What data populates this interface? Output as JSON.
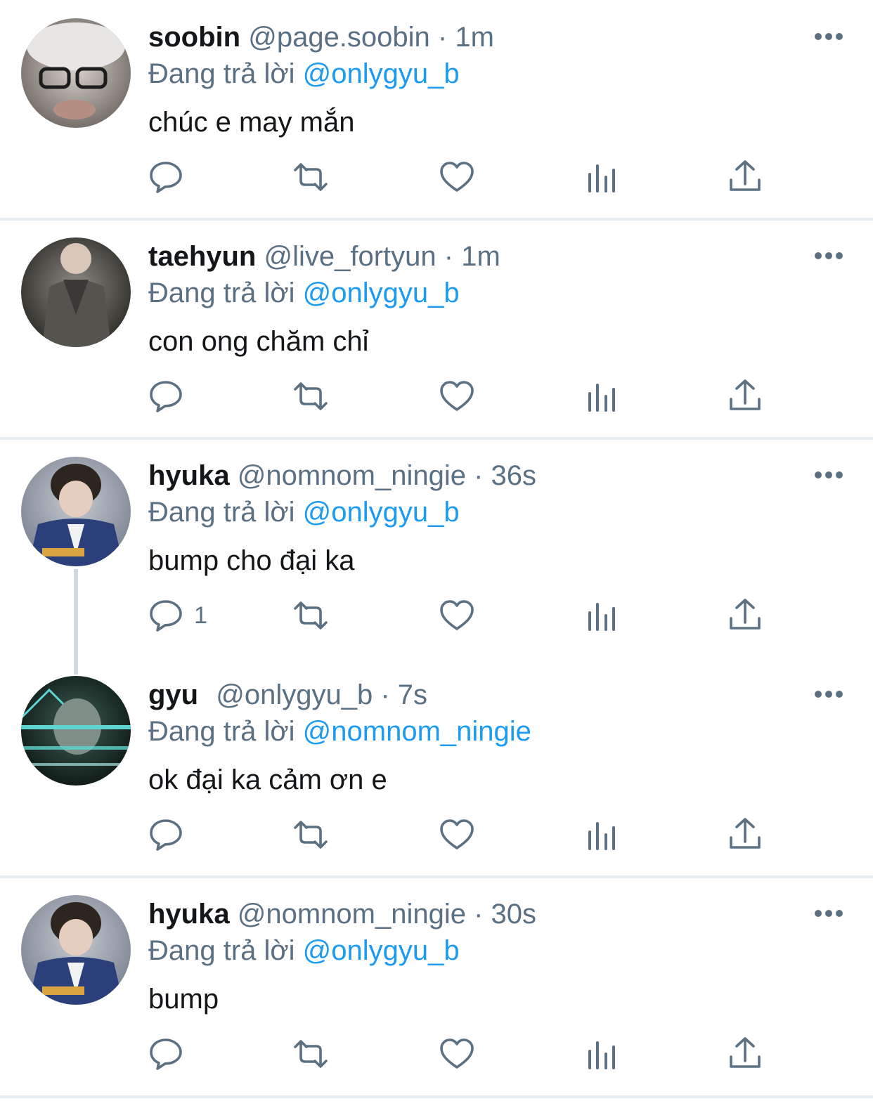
{
  "tweets": [
    {
      "name": "soobin",
      "handle": "@page.soobin",
      "separator": "·",
      "time": "1m",
      "replying_label": "Đang trả lời",
      "replying_to": "@onlygyu_b",
      "text": "chúc e may mắn",
      "reply_count": "",
      "avatar_colors": [
        "#c9c6c3",
        "#6e6761"
      ]
    },
    {
      "name": "taehyun",
      "handle": "@live_fortyun",
      "separator": "·",
      "time": "1m",
      "replying_label": "Đang trả lời",
      "replying_to": "@onlygyu_b",
      "text": "con ong chăm chỉ",
      "reply_count": "",
      "avatar_colors": [
        "#3b3a34",
        "#8d8b86"
      ]
    },
    {
      "name": "hyuka",
      "handle": "@nomnom_ningie",
      "separator": "·",
      "time": "36s",
      "replying_label": "Đang trả lời",
      "replying_to": "@onlygyu_b",
      "text": "bump cho đại ka",
      "reply_count": "1",
      "avatar_colors": [
        "#9fa8b5",
        "#2b3f7a"
      ]
    },
    {
      "name": "gyu",
      "handle": "@onlygyu_b",
      "separator": "·",
      "time": "7s",
      "replying_label": "Đang trả lời",
      "replying_to": "@nomnom_ningie",
      "text": "ok đại ka cảm ơn e",
      "reply_count": "",
      "avatar_colors": [
        "#12211c",
        "#5fd4d0"
      ]
    },
    {
      "name": "hyuka",
      "handle": "@nomnom_ningie",
      "separator": "·",
      "time": "30s",
      "replying_label": "Đang trả lời",
      "replying_to": "@onlygyu_b",
      "text": "bump",
      "reply_count": "",
      "avatar_colors": [
        "#9fa8b5",
        "#2b3f7a"
      ]
    }
  ],
  "icons": {
    "reply": "speech-bubble",
    "retweet": "retweet-arrows",
    "like": "heart",
    "views": "bar-chart",
    "share": "upload-arrow",
    "more": "three-dots"
  },
  "colors": {
    "text": "#14171a",
    "secondary": "#5b7083",
    "link": "#1d9bf0",
    "divider": "#e6ecf0",
    "icon": "#5b7083"
  }
}
